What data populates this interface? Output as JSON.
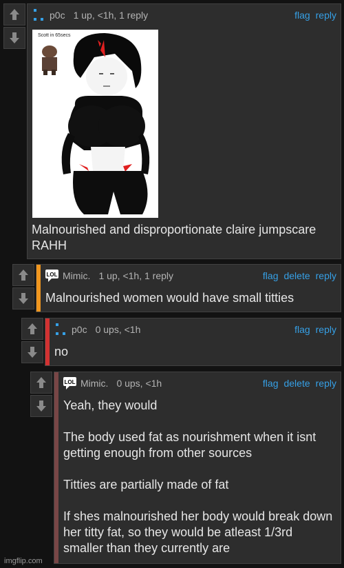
{
  "comments": [
    {
      "username": "p0c",
      "meta": "1 up, <1h, 1 reply",
      "actions": [
        "flag",
        "reply"
      ],
      "body": [
        "Malnourished and disproportionate claire jumpscare RAHH"
      ],
      "image_caption": "Scott in 65secs",
      "accent": "#2d2d2d",
      "avatar_icon": "dots-icon"
    },
    {
      "username": "Mimic.",
      "meta": "1 up, <1h, 1 reply",
      "actions": [
        "flag",
        "delete",
        "reply"
      ],
      "body": [
        "Malnourished women would have small titties"
      ],
      "accent": "#f0961e",
      "avatar_icon": "lol-icon"
    },
    {
      "username": "p0c",
      "meta": "0 ups, <1h",
      "actions": [
        "flag",
        "reply"
      ],
      "body": [
        "no"
      ],
      "accent": "#d23232",
      "avatar_icon": "dots-icon"
    },
    {
      "username": "Mimic.",
      "meta": "0 ups, <1h",
      "actions": [
        "flag",
        "delete",
        "reply"
      ],
      "body": [
        "Yeah, they would",
        "The body used fat as nourishment when it isnt getting enough from other sources",
        "Titties are partially made of fat",
        "If shes malnourished her body would break down her titty fat, so they would be atleast 1/3rd smaller than they currently are"
      ],
      "accent": "#784646",
      "avatar_icon": "lol-icon"
    }
  ],
  "watermark": "imgflip.com",
  "colors": {
    "link": "#36a0e6",
    "panel": "#2d2d2d",
    "background": "#121212"
  }
}
